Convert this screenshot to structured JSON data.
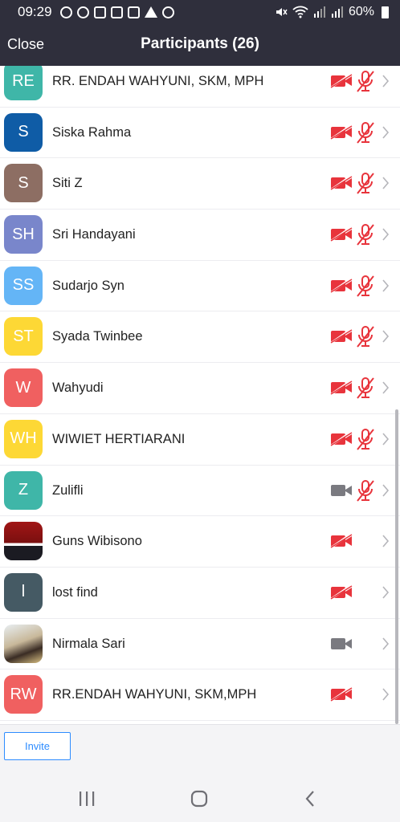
{
  "status_bar": {
    "time": "09:29",
    "battery": "60%",
    "left_icons": [
      "instagram-icon",
      "instagram-icon",
      "message-icon",
      "image-icon",
      "video-icon",
      "alert-icon",
      "whatsapp-icon"
    ],
    "right_icons": [
      "mute-icon",
      "wifi-icon",
      "signal-icon",
      "signal-icon",
      "battery-icon"
    ]
  },
  "header": {
    "close_label": "Close",
    "title": "Participants (26)"
  },
  "participants": [
    {
      "initials": "RE",
      "name": "RR. ENDAH WAHYUNI, SKM, MPH",
      "color": "#3fb6a8",
      "video": "off",
      "audio": "muted"
    },
    {
      "initials": "S",
      "name": "Siska Rahma",
      "color": "#0f5ca6",
      "video": "off",
      "audio": "muted"
    },
    {
      "initials": "S",
      "name": "Siti Z",
      "color": "#8d6e63",
      "video": "off",
      "audio": "muted"
    },
    {
      "initials": "SH",
      "name": "Sri Handayani",
      "color": "#7986cb",
      "video": "off",
      "audio": "muted"
    },
    {
      "initials": "SS",
      "name": "Sudarjo Syn",
      "color": "#64b5f6",
      "video": "off",
      "audio": "muted"
    },
    {
      "initials": "ST",
      "name": "Syada Twinbee",
      "color": "#fdd835",
      "video": "off",
      "audio": "muted"
    },
    {
      "initials": "W",
      "name": "Wahyudi",
      "color": "#f06060",
      "video": "off",
      "audio": "muted"
    },
    {
      "initials": "WH",
      "name": "WIWIET HERTIARANI",
      "color": "#fdd835",
      "video": "off",
      "audio": "muted"
    },
    {
      "initials": "Z",
      "name": "Zulifli",
      "color": "#3fb6a8",
      "video": "on",
      "audio": "muted"
    },
    {
      "initials": "",
      "name": "Guns Wibisono",
      "color": "#a11616",
      "video": "off",
      "audio": "none",
      "photo": "photo1"
    },
    {
      "initials": "l",
      "name": "lost find",
      "color": "#455a64",
      "video": "off",
      "audio": "none"
    },
    {
      "initials": "",
      "name": "Nirmala Sari",
      "color": "#c8b89a",
      "video": "on",
      "audio": "none",
      "photo": "photo2"
    },
    {
      "initials": "RW",
      "name": "RR.ENDAH WAHYUNI, SKM,MPH",
      "color": "#f06060",
      "video": "off",
      "audio": "none"
    }
  ],
  "footer": {
    "invite_label": "Invite"
  },
  "colors": {
    "header_bg": "#2f2f3c",
    "muted_red": "#e8343c",
    "icon_gray": "#7a7a80",
    "accent_blue": "#2d8cff"
  },
  "android_nav": [
    "recent-apps-icon",
    "home-icon",
    "back-icon"
  ]
}
